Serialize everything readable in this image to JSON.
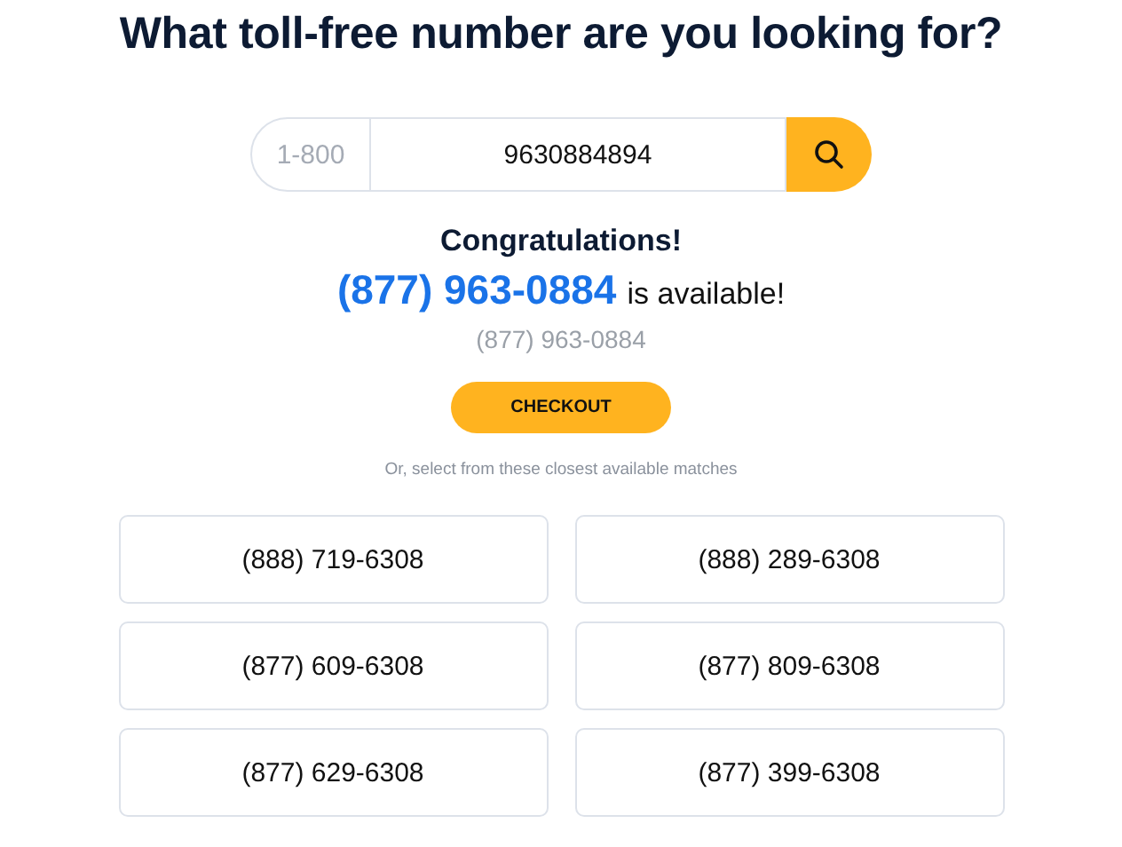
{
  "title": "What toll-free number are you looking for?",
  "search": {
    "prefix": "1-800",
    "value": "9630884894"
  },
  "result": {
    "heading": "Congratulations!",
    "number": "(877) 963-0884",
    "suffix": "is available!",
    "subtitle": "(877) 963-0884"
  },
  "checkout": "CHECKOUT",
  "hint": "Or, select from these closest available matches",
  "matches": [
    "(888) 719-6308",
    "(888) 289-6308",
    "(877) 609-6308",
    "(877) 809-6308",
    "(877) 629-6308",
    "(877) 399-6308"
  ]
}
